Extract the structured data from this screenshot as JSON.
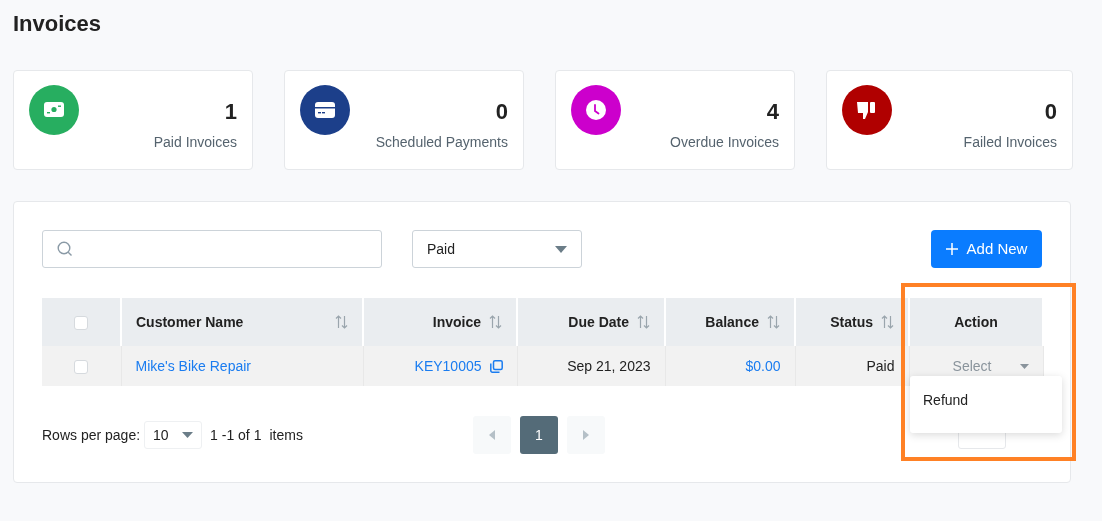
{
  "page": {
    "title": "Invoices"
  },
  "stats": [
    {
      "kind": "cash",
      "color": "#27ae60",
      "value": "1",
      "label": "Paid Invoices"
    },
    {
      "kind": "card",
      "color": "#1c3f8a",
      "value": "0",
      "label": "Scheduled Payments"
    },
    {
      "kind": "clock",
      "color": "#cc00cc",
      "value": "4",
      "label": "Overdue Invoices"
    },
    {
      "kind": "thumbs-down",
      "color": "#b00000",
      "value": "0",
      "label": "Failed Invoices"
    }
  ],
  "toolbar": {
    "status_filter": {
      "value": "Paid"
    },
    "add_button": {
      "label": "Add New"
    }
  },
  "table": {
    "select_all": {
      "checked": false
    },
    "columns": [
      {
        "label": "Customer Name",
        "sortable": true
      },
      {
        "label": "Invoice",
        "sortable": true
      },
      {
        "label": "Due Date",
        "sortable": true
      },
      {
        "label": "Balance",
        "sortable": true
      },
      {
        "label": "Status",
        "sortable": true
      },
      {
        "label": "Action",
        "sortable": false
      }
    ],
    "rows": [
      {
        "checked": false,
        "customer": "Mike's Bike Repair",
        "invoice": "KEY10005",
        "due_date": "Sep 21, 2023",
        "balance": "$0.00",
        "status": "Paid",
        "action": {
          "placeholder": "Select"
        }
      }
    ]
  },
  "action_menu": {
    "items": [
      {
        "label": "Refund"
      }
    ]
  },
  "pagination": {
    "rows_label": "Rows per page:",
    "rows_per_page": "10",
    "range": "1 -1 of 1",
    "items_label": "items",
    "pages": [
      {
        "label": "1",
        "selected": true
      }
    ]
  },
  "annotation": {
    "kind": "frame"
  }
}
